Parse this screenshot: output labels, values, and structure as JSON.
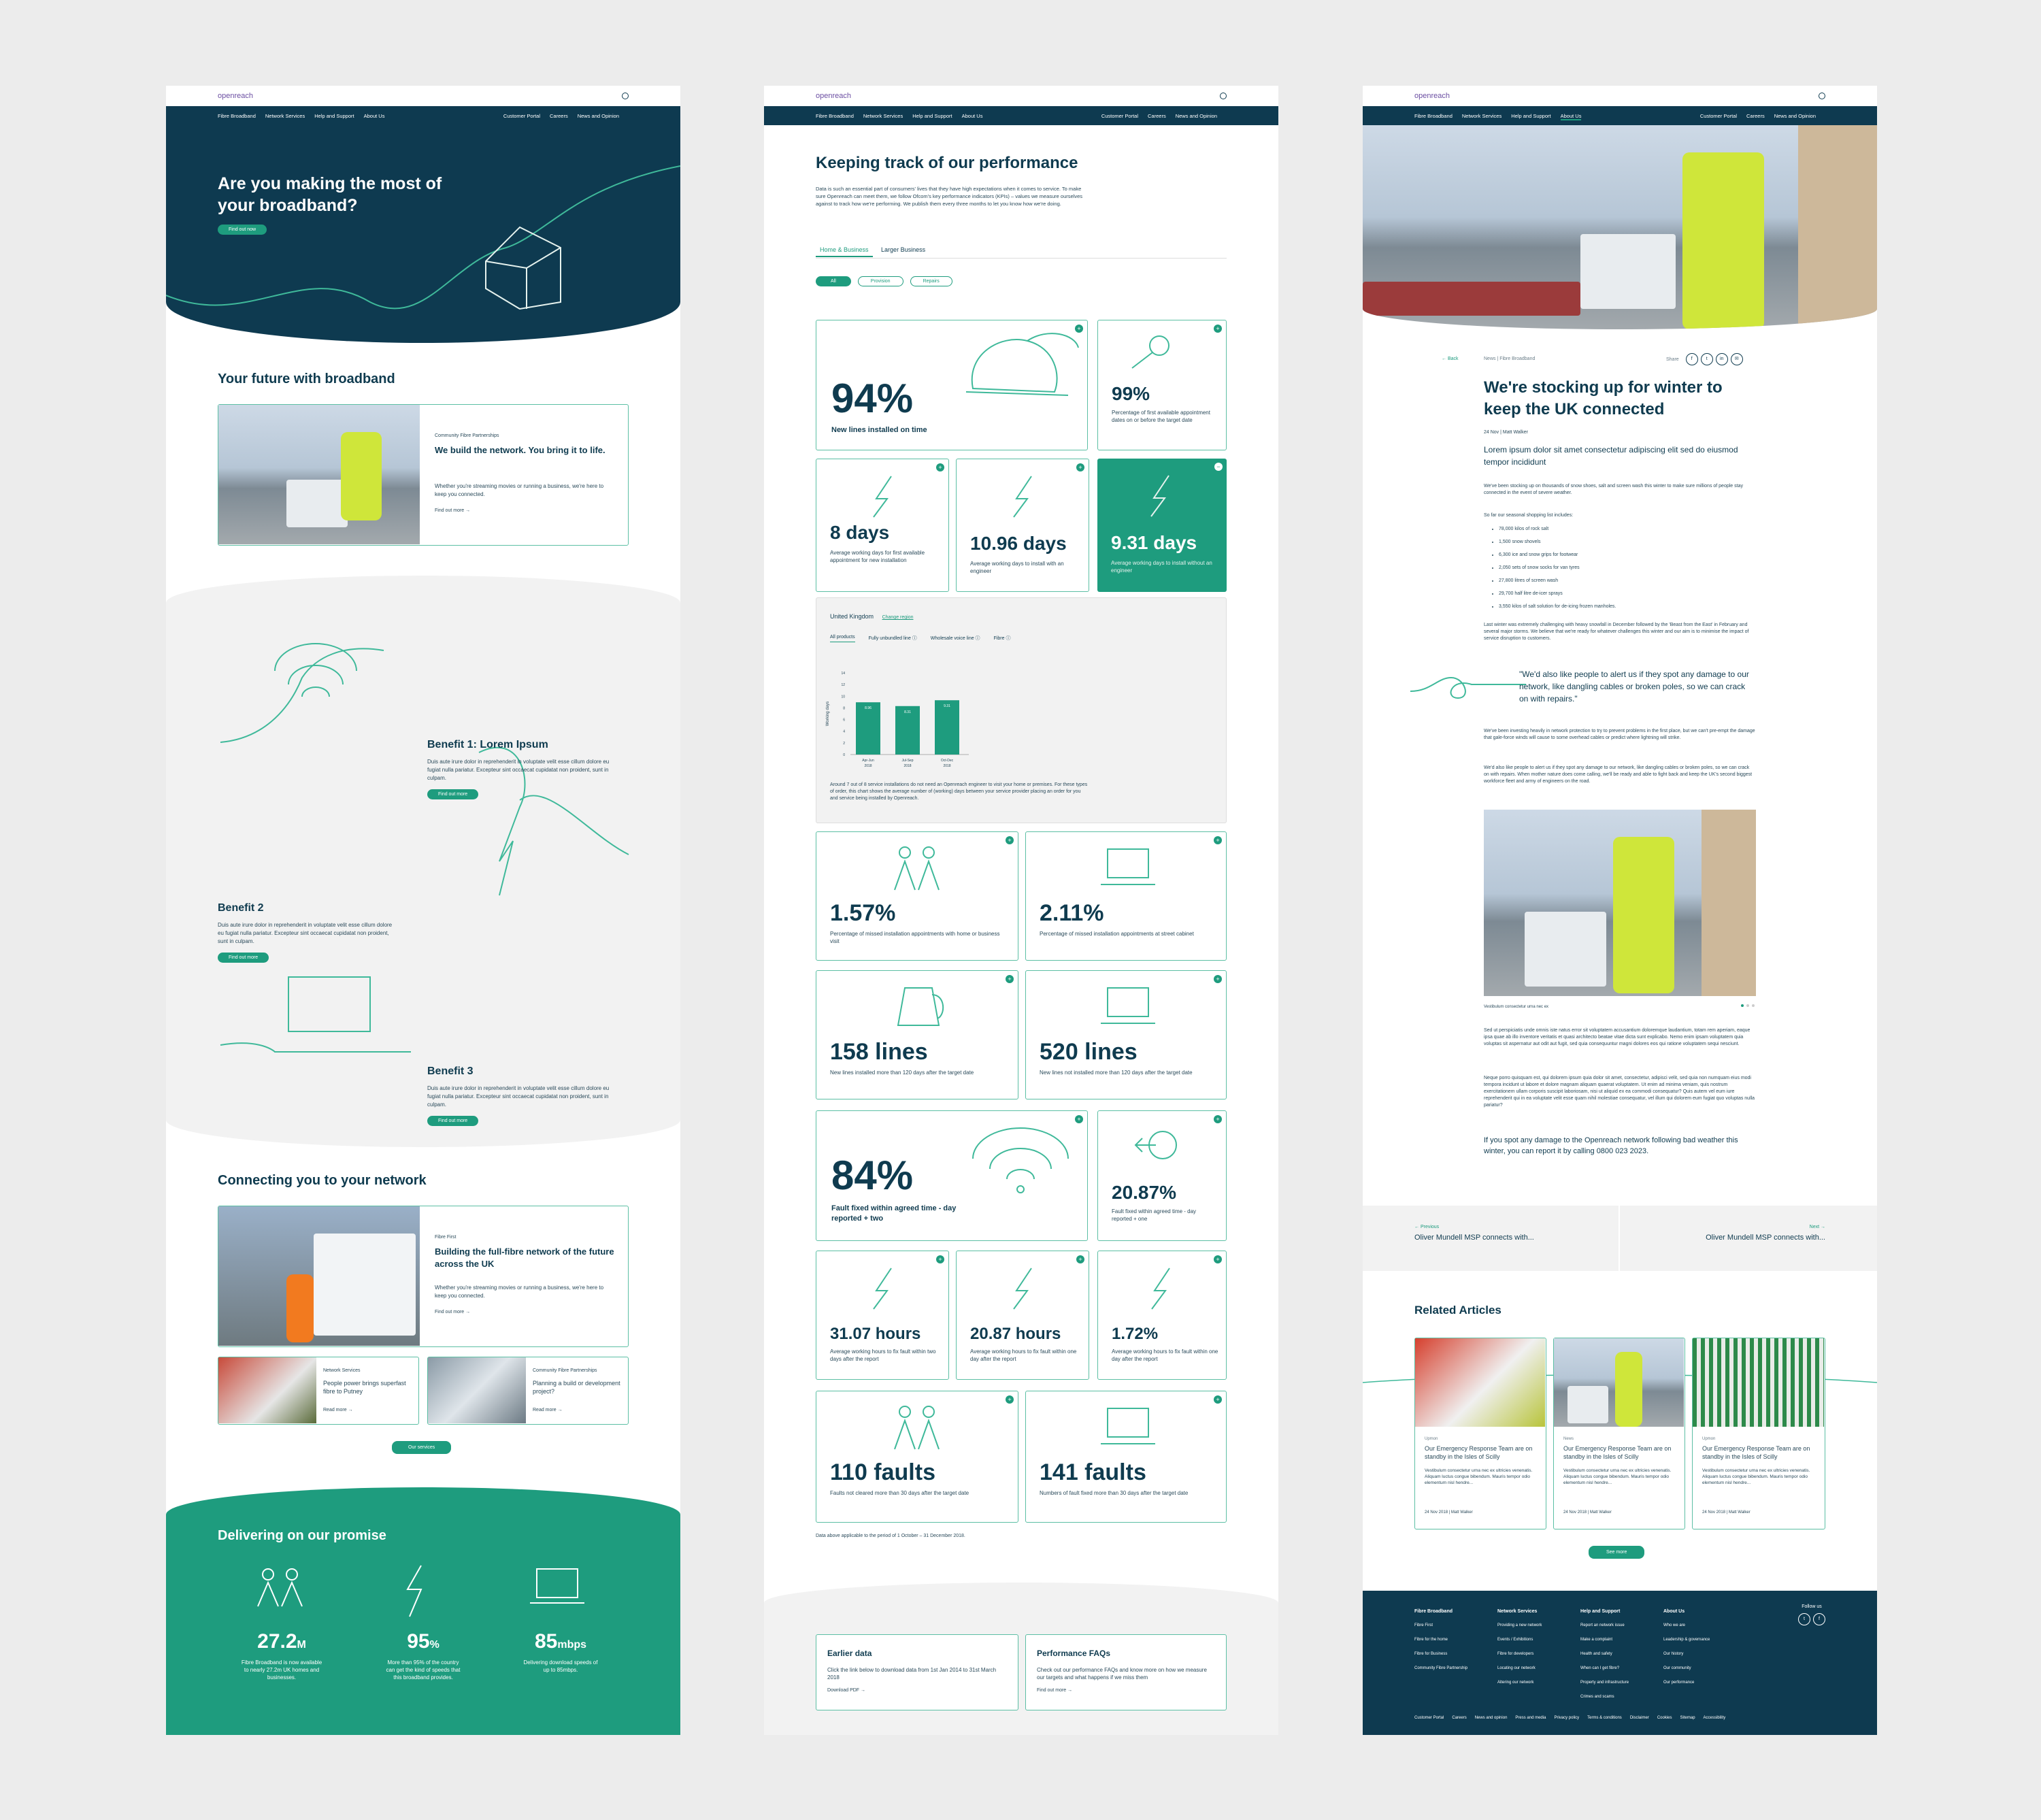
{
  "site": {
    "logo": "openreach",
    "nav_left": [
      "Fibre Broadband",
      "Network Services",
      "Help and Support",
      "About Us"
    ],
    "nav_right": [
      "Customer Portal",
      "Careers",
      "News and Opinion"
    ]
  },
  "home": {
    "hero_title": "Are you making the most of your broadband?",
    "hero_button": "Find out now",
    "future_heading": "Your future with broadband",
    "feature_card": {
      "tag": "Community Fibre Partnerships",
      "title": "We build the network. You bring it to life.",
      "body": "Whether you're streaming movies or running a business, we're here to keep you connected.",
      "link": "Find out more →"
    },
    "benefits": [
      {
        "title": "Benefit 1: Lorem Ipsum",
        "body": "Duis aute irure dolor in reprehenderit in voluptate velit esse cillum dolore eu fugiat nulla pariatur. Excepteur sint occaecat cupidatat non proident, sunt in culpam.",
        "button": "Find out more"
      },
      {
        "title": "Benefit 2",
        "body": "Duis aute irure dolor in reprehenderit in voluptate velit esse cillum dolore eu fugiat nulla pariatur. Excepteur sint occaecat cupidatat non proident, sunt in culpam.",
        "button": "Find out more"
      },
      {
        "title": "Benefit 3",
        "body": "Duis aute irure dolor in reprehenderit in voluptate velit esse cillum dolore eu fugiat nulla pariatur. Excepteur sint occaecat cupidatat non proident, sunt in culpam.",
        "button": "Find out more"
      }
    ],
    "connect_heading": "Connecting you to your network",
    "connect_card": {
      "tag": "Fibre First",
      "title": "Building the full-fibre network of the future across the UK",
      "body": "Whether you're streaming movies or running a business, we're here to keep you connected.",
      "link": "Find out more →"
    },
    "small_cards": [
      {
        "tag": "Network Services",
        "title": "People power brings superfast fibre to Putney",
        "link": "Read more →"
      },
      {
        "tag": "Community Fibre Partnerships",
        "title": "Planning a build or development project?",
        "link": "Read more →"
      }
    ],
    "services_button": "Our services",
    "promise_heading": "Delivering on our promise",
    "stats": [
      {
        "value": "27.2",
        "unit": "M",
        "text": "Fibre Broadband is now available to nearly 27.2m UK homes and businesses."
      },
      {
        "value": "95",
        "unit": "%",
        "text": "More than 95% of the country can get the kind of speeds that this broadband provides."
      },
      {
        "value": "85",
        "unit": "mbps",
        "text": "Delivering download speeds of up to 85mbps."
      }
    ]
  },
  "perf": {
    "title": "Keeping track of our performance",
    "intro": "Data is such an essential part of consumers' lives that they have high expectations when it comes to service. To make sure Openreach can meet them, we follow Ofcom's key performance indicators (KPIs) – values we measure ourselves against to track how we're performing. We publish them every three months to let you know how we're doing.",
    "tabs": [
      "Home & Business",
      "Larger Business"
    ],
    "filters": [
      "All",
      "Provision",
      "Repairs"
    ],
    "kpis_top": [
      {
        "value": "94%",
        "text": "New lines installed on time"
      },
      {
        "value": "99%",
        "text": "Percentage of first available appointment dates on or before the target date"
      }
    ],
    "kpis_row2": [
      {
        "value": "8 days",
        "text": "Average working days for first available appointment for new installation"
      },
      {
        "value": "10.96 days",
        "text": "Average working days to install with an engineer"
      },
      {
        "value": "9.31 days",
        "text": "Average working days to install without an engineer"
      }
    ],
    "chart_panel": {
      "region": "United Kingdom",
      "change": "Change region",
      "tabs": [
        "All products",
        "Fully unbundled line ⓘ",
        "Wholesale voice line ⓘ",
        "Fibre ⓘ"
      ],
      "note": "Around 7 out of 8 service installations do not need an Openreach engineer to visit your home or premises. For these types of order, this chart shows the average number of (working) days between your service provider placing an order for you and service being installed by Openreach."
    },
    "kpis_grid": [
      {
        "value": "1.57%",
        "text": "Percentage of missed installation appointments with home or business visit"
      },
      {
        "value": "2.11%",
        "text": "Percentage of missed installation appointments at street cabinet"
      },
      {
        "value": "158 lines",
        "text": "New lines installed more than 120 days after the target date"
      },
      {
        "value": "520 lines",
        "text": "New lines not installed more than 120 days after the target date"
      }
    ],
    "kpis_fault": [
      {
        "value": "84%",
        "text": "Fault fixed within agreed time - day reported + two"
      },
      {
        "value": "20.87%",
        "text": "Fault fixed within agreed time - day reported + one"
      }
    ],
    "kpis_hours": [
      {
        "value": "31.07 hours",
        "text": "Average working hours to fix fault within two days after the report"
      },
      {
        "value": "20.87 hours",
        "text": "Average working hours to fix fault within one day after the report"
      },
      {
        "value": "1.72%",
        "text": "Average working hours to fix fault within one day after the report"
      }
    ],
    "kpis_faults": [
      {
        "value": "110 faults",
        "text": "Faults not cleared more than 30 days after the target date"
      },
      {
        "value": "141 faults",
        "text": "Numbers of fault fixed more than 30 days after the target date"
      }
    ],
    "footnote": "Data above applicable to the period of 1 October – 31 December 2018.",
    "bottom_cards": [
      {
        "title": "Earlier data",
        "body": "Click the link below to download data from 1st Jan 2014 to 31st March 2018",
        "link": "Download PDF →"
      },
      {
        "title": "Performance FAQs",
        "body": "Check out our performance FAQs and know more on how we measure our targets and what happens if we miss them",
        "link": "Find out more →"
      }
    ]
  },
  "chart_data": {
    "type": "bar",
    "categories": [
      "Apr-Jun 2018",
      "Jul-Sep 2018",
      "Oct-Dec 2018"
    ],
    "values": [
      8.96,
      8.31,
      9.31
    ],
    "ylabel": "Working days",
    "ylim": [
      0,
      14
    ],
    "yticks": [
      0,
      2,
      4,
      6,
      8,
      10,
      12,
      14
    ],
    "color": "#1e9c7e"
  },
  "article": {
    "back": "← Back",
    "crumb": "News | Fibre Broadband",
    "share": "Share",
    "title": "We're stocking up for winter to keep the UK connected",
    "meta": "24 Nov | Matt Walker",
    "lead": "Lorem ipsum dolor sit amet consectetur adipiscing elit sed do eiusmod tempor incididunt",
    "p1": "We've been stocking up on thousands of snow shoes, salt and screen wash this winter to make sure millions of people stay connected in the event of severe weather.",
    "list_intro": "So far our seasonal shopping list includes:",
    "list": [
      "78,000 kilos of rock salt",
      "1,500 snow shovels",
      "6,300 ice and snow grips for footwear",
      "2,050 sets of snow socks for van tyres",
      "27,800 litres of screen wash",
      "29,700 half litre de-icer sprays",
      "3,550 kilos of salt solution for de-icing frozen manholes."
    ],
    "p2": "Last winter was extremely challenging with heavy snowfall in December followed by the 'Beast from the East' in February and several major storms. We believe that we're ready for whatever challenges this winter and our aim is to minimise the impact of service disruption to customers.",
    "quote": "\"We'd also like people to alert us if they spot any damage to our network, like dangling cables or broken poles, so we can crack on with repairs.\"",
    "p3": "We've been investing heavily in network protection to try to prevent problems in the first place, but we can't pre-empt the damage that gale-force winds will cause to some overhead cables or predict where lightning will strike.",
    "p4": "We'd also like people to alert us if they spot any damage to our network, like dangling cables or broken poles, so we can crack on with repairs. When mother nature does come calling, we'll be ready and able to fight back and keep the UK's second biggest workforce fleet and army of engineers on the road.",
    "caption": "Vestibulum consectetur urna nec ex",
    "p5": "Sed ut perspiciatis unde omnis iste natus error sit voluptatem accusantium doloremque laudantium, totam rem aperiam, eaque ipsa quae ab illo inventore veritatis et quasi architecto beatae vitae dicta sunt explicabo. Nemo enim ipsam voluptatem quia voluptas sit aspernatur aut odit aut fugit, sed quia consequuntur magni dolores eos qui ratione voluptatem sequi nesciunt.",
    "p6": "Neque porro quisquam est, qui dolorem ipsum quia dolor sit amet, consectetur, adipisci velit, sed quia non numquam eius modi tempora incidunt ut labore et dolore magnam aliquam quaerat voluptatem. Ut enim ad minima veniam, quis nostrum exercitationem ullam corporis suscipit laboriosam, nisi ut aliquid ex ea commodi consequatur? Quis autem vel eum iure reprehenderit qui in ea voluptate velit esse quam nihil molestiae consequatur, vel illum qui dolorem eum fugiat quo voluptas nulla pariatur?",
    "closing": "If you spot any damage to the Openreach network following bad weather this winter, you can report it by calling 0800 023 2023.",
    "prev_label": "← Previous",
    "prev_title": "Oliver Mundell MSP connects with...",
    "next_label": "Next →",
    "next_title": "Oliver Mundell MSP connects with...",
    "related_heading": "Related Articles",
    "related": [
      {
        "tag": "Upmon",
        "title": "Our Emergency Response Team are on standby in the Isles of Scilly",
        "body": "Vestibulum consectetur urna nec ex ultricies venenatis. Aliquam luctus congue bibendum. Mauris tempor odio elementum nisl hendre...",
        "meta": "24 Nov 2018 | Matt Walker"
      },
      {
        "tag": "News",
        "title": "Our Emergency Response Team are on standby in the Isles of Scilly",
        "body": "Vestibulum consectetur urna nec ex ultricies venenatis. Aliquam luctus congue bibendum. Mauris tempor odio elementum nisl hendre...",
        "meta": "24 Nov 2018 | Matt Walker"
      },
      {
        "tag": "Upmon",
        "title": "Our Emergency Response Team are on standby in the Isles of Scilly",
        "body": "Vestibulum consectetur urna nec ex ultricies venenatis. Aliquam luctus congue bibendum. Mauris tempor odio elementum nisl hendre...",
        "meta": "24 Nov 2018 | Matt Walker"
      }
    ],
    "see_more": "See more"
  },
  "footer": {
    "cols": [
      {
        "title": "Fibre Broadband",
        "items": [
          "Fibre First",
          "Fibre for the home",
          "Fibre for Business",
          "Community Fibre Partnership"
        ]
      },
      {
        "title": "Network Services",
        "items": [
          "Providing a new network",
          "Events / Exhibitions",
          "Fibre for developers",
          "Locating our network",
          "Altering our network"
        ]
      },
      {
        "title": "Help and Support",
        "items": [
          "Report an network issue",
          "Make a complaint",
          "Health and safety",
          "When can I get fibre?",
          "Property and infrastructure",
          "Crimes and scams"
        ]
      },
      {
        "title": "About Us",
        "items": [
          "Who we are",
          "Leadership & governance",
          "Our history",
          "Our community",
          "Our performance"
        ]
      }
    ],
    "follow": "Follow us",
    "bottom": [
      "Customer Portal",
      "Careers",
      "News and opinion",
      "Press and media",
      "Privacy policy",
      "Terms & conditions",
      "Disclaimer",
      "Cookies",
      "Sitemap",
      "Accessibility"
    ]
  }
}
